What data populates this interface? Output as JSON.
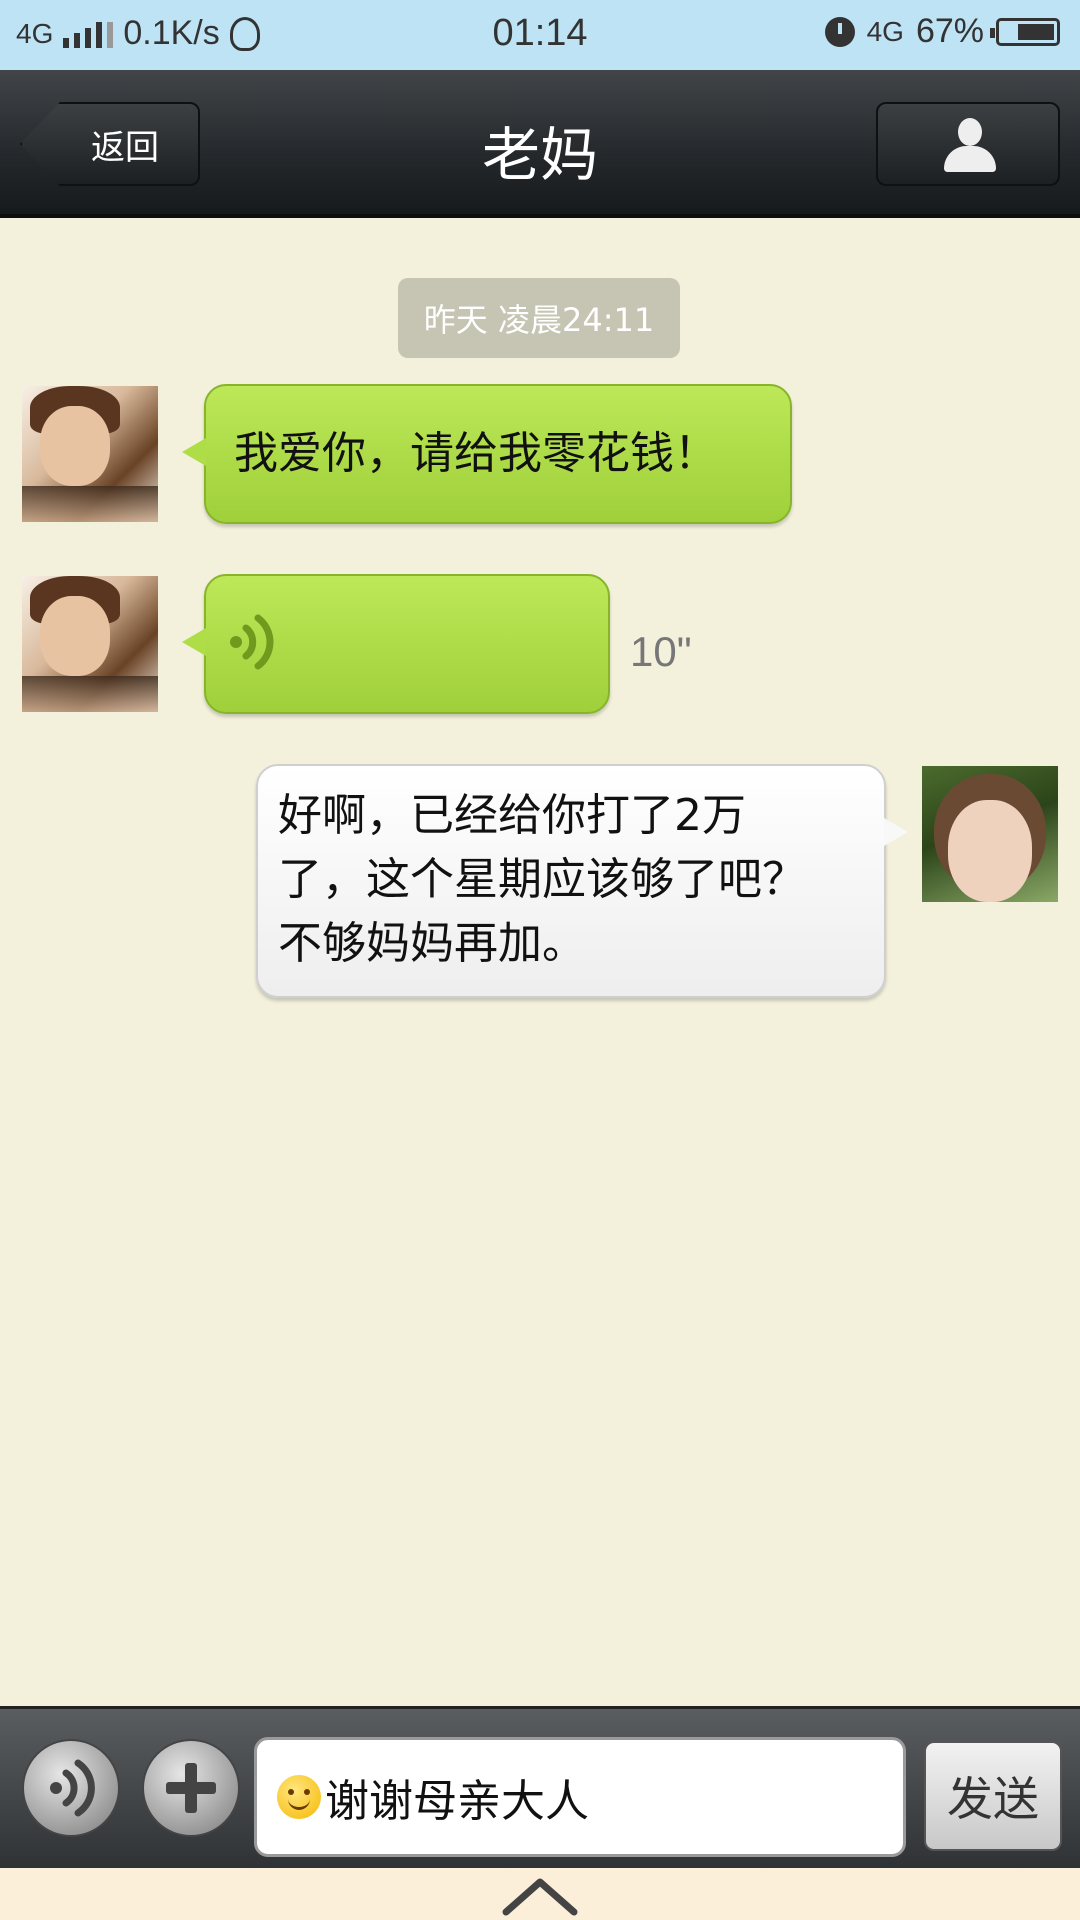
{
  "status_bar": {
    "network": "4G",
    "speed": "0.1K/s",
    "time": "01:14",
    "data_type": "4G",
    "battery": "67%"
  },
  "header": {
    "back_label": "返回",
    "title": "老妈",
    "profile_icon": "person-icon"
  },
  "chat": {
    "timestamp": "昨天 凌晨24:11",
    "messages": [
      {
        "from": "contact",
        "type": "text",
        "text": "我爱你，请给我零花钱！"
      },
      {
        "from": "contact",
        "type": "voice",
        "duration": "10\""
      },
      {
        "from": "me",
        "type": "text",
        "lines": [
          "好啊，已经给你打了2万",
          "了，这个星期应该够了吧？",
          "不够妈妈再加。"
        ]
      }
    ]
  },
  "input_bar": {
    "voice_icon": "voice-icon",
    "plus_icon": "plus-icon",
    "input_value": "谢谢母亲大人",
    "send_label": "发送"
  },
  "colors": {
    "chat_background": "#f3f0dc",
    "incoming_bubble": "#a9d840",
    "outgoing_bubble": "#f5f5f5",
    "status_bar": "#bde3f4"
  }
}
